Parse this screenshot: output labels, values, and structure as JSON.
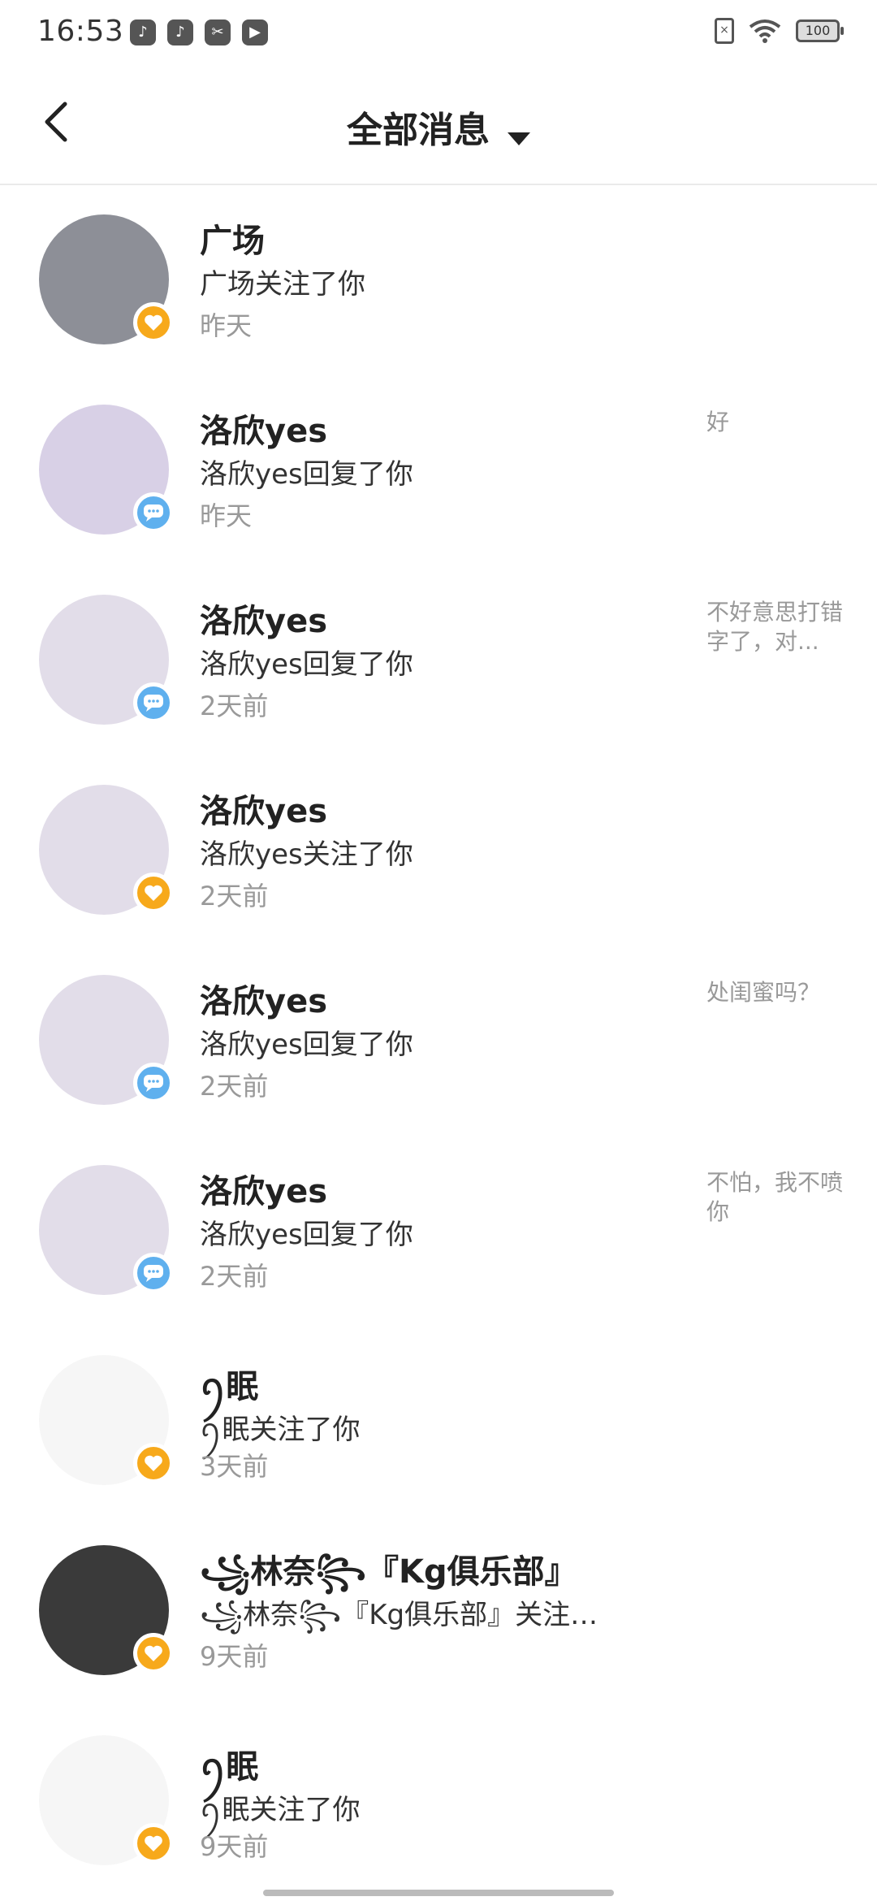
{
  "status_bar": {
    "time": "16:53",
    "apps": [
      "tiktok-icon",
      "tiktok-icon",
      "capcut-icon",
      "video-icon"
    ],
    "battery": "100"
  },
  "header": {
    "title": "全部消息"
  },
  "messages": [
    {
      "name": "广场",
      "action": "广场关注了你",
      "time": "昨天",
      "preview": "",
      "type": "follow",
      "avatar_color": "#8d8f97"
    },
    {
      "name": "洛欣yes",
      "action": "洛欣yes回复了你",
      "time": "昨天",
      "preview": "好",
      "type": "reply",
      "avatar_color": "#d8d0e6"
    },
    {
      "name": "洛欣yes",
      "action": "洛欣yes回复了你",
      "time": "2天前",
      "preview": "不好意思打错字了，对...",
      "type": "reply",
      "avatar_color": "#e2dde9"
    },
    {
      "name": "洛欣yes",
      "action": "洛欣yes关注了你",
      "time": "2天前",
      "preview": "",
      "type": "follow",
      "avatar_color": "#e2dde9"
    },
    {
      "name": "洛欣yes",
      "action": "洛欣yes回复了你",
      "time": "2天前",
      "preview": "处闺蜜吗？",
      "type": "reply",
      "avatar_color": "#e2dde9"
    },
    {
      "name": "洛欣yes",
      "action": "洛欣yes回复了你",
      "time": "2天前",
      "preview": "不怕，我不喷你",
      "type": "reply",
      "avatar_color": "#e2dde9"
    },
    {
      "name": "ꪆ眠",
      "action": "ꪆ眠关注了你",
      "time": "3天前",
      "preview": "",
      "type": "follow",
      "avatar_color": "#f6f6f6"
    },
    {
      "name": "꧁林奈꧂『Kg俱乐部』",
      "action": "꧁林奈꧂『Kg俱乐部』关注…",
      "time": "9天前",
      "preview": "",
      "type": "follow",
      "avatar_color": "#3a3a3a"
    },
    {
      "name": "ꪆ眠",
      "action": "ꪆ眠关注了你",
      "time": "9天前",
      "preview": "",
      "type": "follow",
      "avatar_color": "#f6f6f6"
    }
  ]
}
